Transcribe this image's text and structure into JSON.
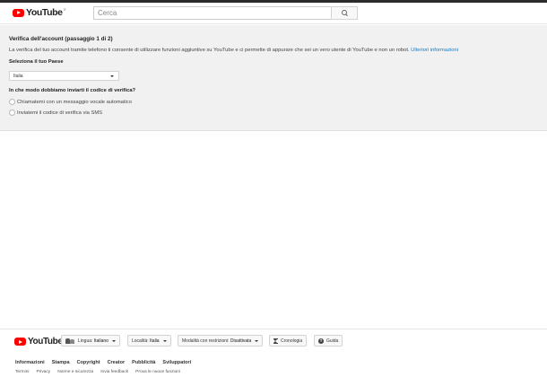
{
  "masthead": {
    "logo_text": "YouTube",
    "logo_region": "IT",
    "search_placeholder": "Cerca"
  },
  "verification": {
    "title": "Verifica dell'account (passaggio 1 di 2)",
    "description": "La verifica del tuo account tramite telefono ti consente di utilizzare funzioni aggiuntive su YouTube e ci permette di appurare che sei un vero utente di YouTube e non un robot.",
    "learn_more_link": "Ulteriori informazioni",
    "country_label": "Seleziona il tuo Paese",
    "country_value": "Italia",
    "method_label": "In che modo dobbiamo inviarti il codice di verifica?",
    "methods": [
      {
        "label": "Chiamatemi con un messaggio vocale automatico"
      },
      {
        "label": "Inviatemi il codice di verifica via SMS"
      }
    ]
  },
  "footer": {
    "logo_text": "YouTube",
    "language_prefix": "Lingua:",
    "language_value": "Italiano",
    "location_prefix": "Località:",
    "location_value": "Italia",
    "restricted_prefix": "Modalità con restrizioni:",
    "restricted_value": "Disattivata",
    "history_label": "Cronologia",
    "help_label": "Guida",
    "links_primary": [
      "Informazioni",
      "Stampa",
      "Copyright",
      "Creator",
      "Pubblicità",
      "Sviluppatori"
    ],
    "links_secondary": [
      "Termini",
      "Privacy",
      "Norme e sicurezza",
      "Invia feedback",
      "Prova le nuove funzioni"
    ]
  },
  "colors": {
    "brand_red": "#ff0000",
    "link_blue": "#167ac6",
    "panel_background": "#f1f1f1"
  },
  "icons": [
    "youtube-logo-icon",
    "search-icon",
    "chevron-down-icon",
    "language-users-icon",
    "hourglass-icon",
    "help-icon"
  ]
}
